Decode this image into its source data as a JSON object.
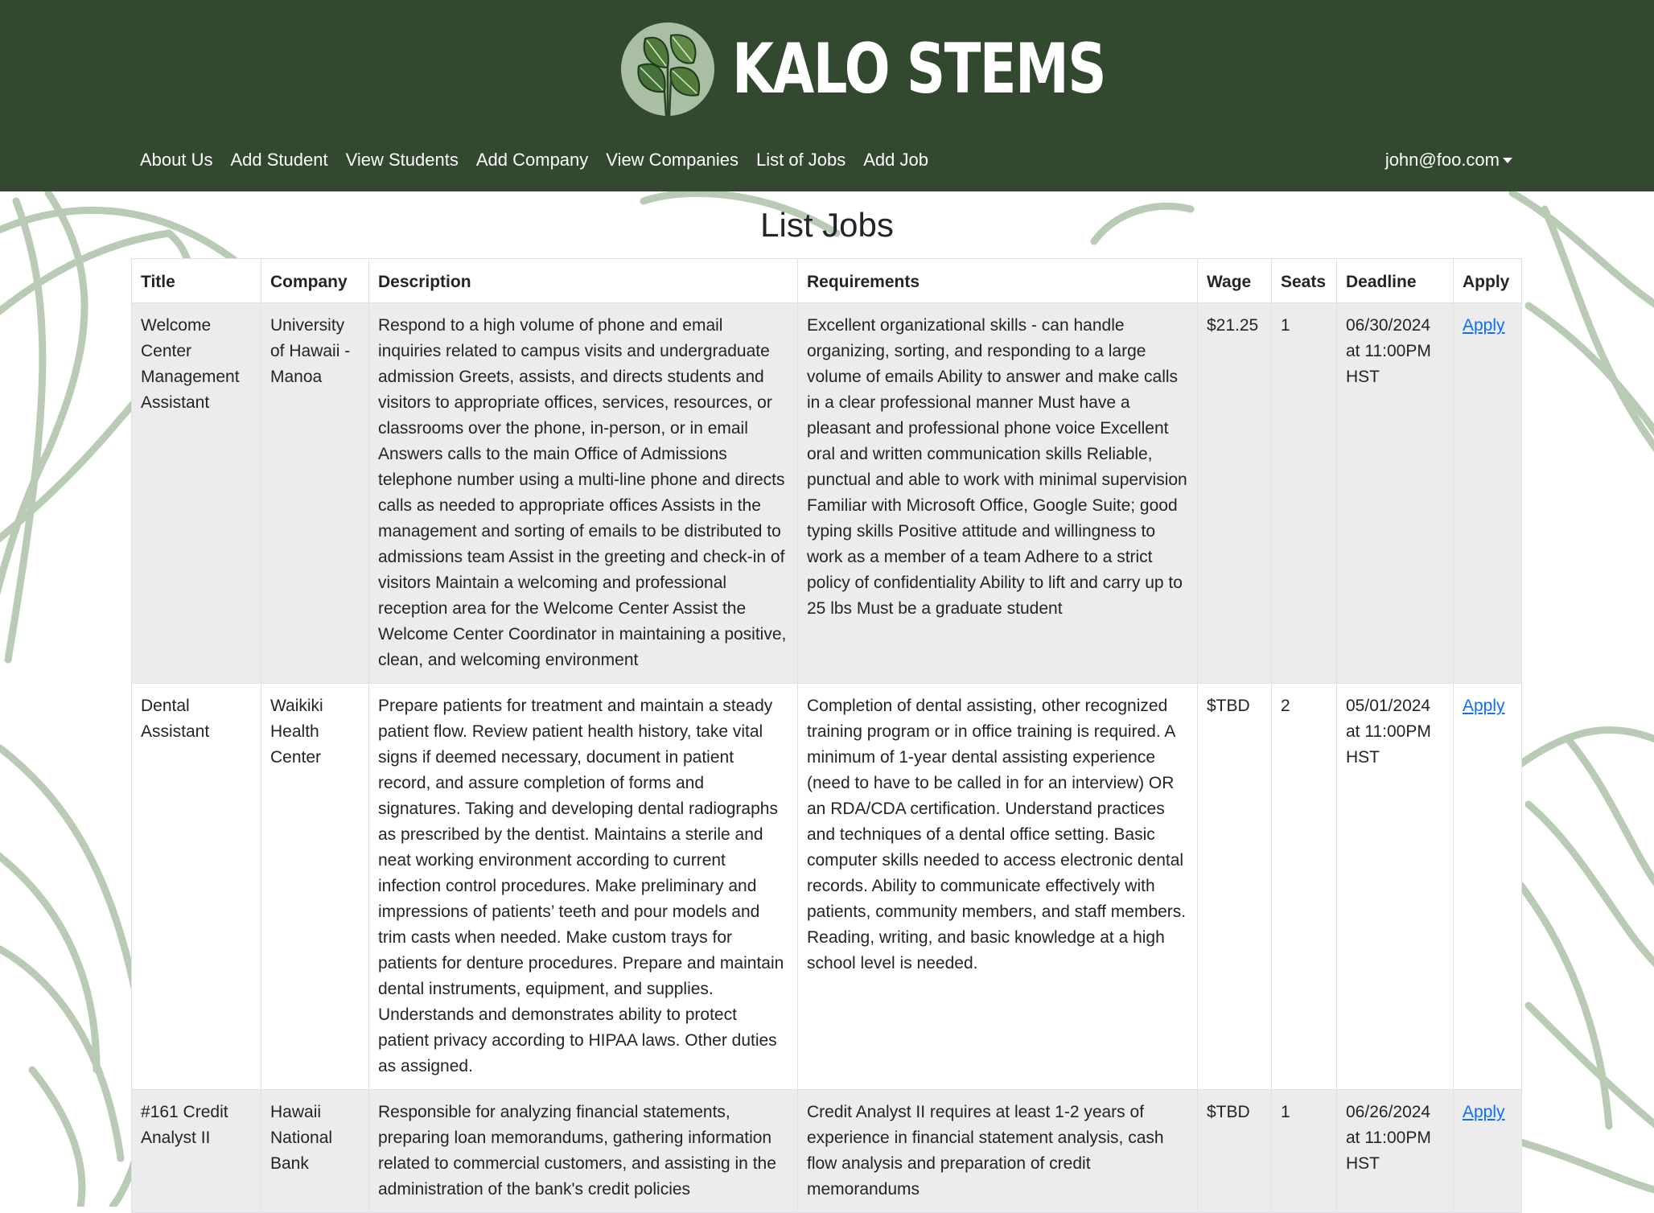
{
  "brand": {
    "name": "KALO STEMS",
    "logo_icon": "taro-leaf-logo-icon"
  },
  "colors": {
    "header_bg": "#32482f",
    "logo_bg": "#a9bea3",
    "link": "#0d6efd",
    "stripe": "#ececec"
  },
  "nav": {
    "items": [
      {
        "label": "About Us"
      },
      {
        "label": "Add Student"
      },
      {
        "label": "View Students"
      },
      {
        "label": "Add Company"
      },
      {
        "label": "View Companies"
      },
      {
        "label": "List of Jobs"
      },
      {
        "label": "Add Job"
      }
    ],
    "user": "john@foo.com"
  },
  "page": {
    "title": "List Jobs"
  },
  "table": {
    "columns": [
      "Title",
      "Company",
      "Description",
      "Requirements",
      "Wage",
      "Seats",
      "Deadline",
      "Apply"
    ],
    "rows": [
      {
        "title": "Welcome Center Management Assistant",
        "company": "University of Hawaii - Manoa",
        "description": "Respond to a high volume of phone and email inquiries related to campus visits and undergraduate admission Greets, assists, and directs students and visitors to appropriate offices, services, resources, or classrooms over the phone, in-person, or in email Answers calls to the main Office of Admissions telephone number using a multi-line phone and directs calls as needed to appropriate offices Assists in the management and sorting of emails to be distributed to admissions team Assist in the greeting and check-in of visitors Maintain a welcoming and professional reception area for the Welcome Center Assist the Welcome Center Coordinator in maintaining a positive, clean, and welcoming environment",
        "requirements": "Excellent organizational skills - can handle organizing, sorting, and responding to a large volume of emails Ability to answer and make calls in a clear professional manner Must have a pleasant and professional phone voice Excellent oral and written communication skills Reliable, punctual and able to work with minimal supervision Familiar with Microsoft Office, Google Suite; good typing skills Positive attitude and willingness to work as a member of a team Adhere to a strict policy of confidentiality Ability to lift and carry up to 25 lbs Must be a graduate student",
        "wage": "$21.25",
        "seats": "1",
        "deadline": "06/30/2024 at 11:00PM HST",
        "apply": "Apply"
      },
      {
        "title": "Dental Assistant",
        "company": "Waikiki Health Center",
        "description": "Prepare patients for treatment and maintain a steady patient flow. Review patient health history, take vital signs if deemed necessary, document in patient record, and assure completion of forms and signatures. Taking and developing dental radiographs as prescribed by the dentist. Maintains a sterile and neat working environment according to current infection control procedures. Make preliminary and impressions of patients’ teeth and pour models and trim casts when needed. Make custom trays for patients for denture procedures. Prepare and maintain dental instruments, equipment, and supplies. Understands and demonstrates ability to protect patient privacy according to HIPAA laws. Other duties as assigned.",
        "requirements": "Completion of dental assisting, other recognized training program or in office training is required. A minimum of 1-year dental assisting experience (need to have to be called in for an interview) OR an RDA/CDA certification. Understand practices and techniques of a dental office setting. Basic computer skills needed to access electronic dental records. Ability to communicate effectively with patients, community members, and staff members. Reading, writing, and basic knowledge at a high school level is needed.",
        "wage": "$TBD",
        "seats": "2",
        "deadline": "05/01/2024 at 11:00PM HST",
        "apply": "Apply"
      },
      {
        "title": "#161 Credit Analyst II",
        "company": "Hawaii National Bank",
        "description": "Responsible for analyzing financial statements, preparing loan memorandums, gathering information related to commercial customers, and assisting in the administration of the bank's credit policies",
        "requirements": "Credit Analyst II requires at least 1-2 years of experience in financial statement analysis, cash flow analysis and preparation of credit memorandums",
        "wage": "$TBD",
        "seats": "1",
        "deadline": "06/26/2024 at 11:00PM HST",
        "apply": "Apply"
      }
    ]
  }
}
